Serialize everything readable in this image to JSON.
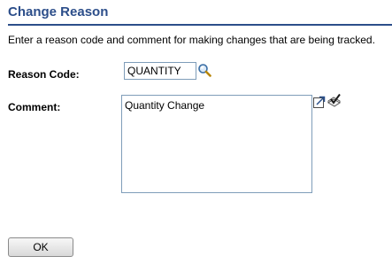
{
  "header": {
    "title": "Change Reason"
  },
  "instructions": "Enter a reason code and comment for making changes that are being tracked.",
  "form": {
    "reason_code_label": "Reason Code:",
    "reason_code_value": "QUANTITY",
    "comment_label": "Comment:",
    "comment_value": "Quantity Change"
  },
  "icons": {
    "lookup": "magnifier-lookup-icon",
    "expand": "expand-field-icon",
    "spell_check": "spell-check-icon"
  },
  "buttons": {
    "ok_label": "OK"
  },
  "colors": {
    "title": "#2c4e8a",
    "field_border": "#7f9db9"
  }
}
